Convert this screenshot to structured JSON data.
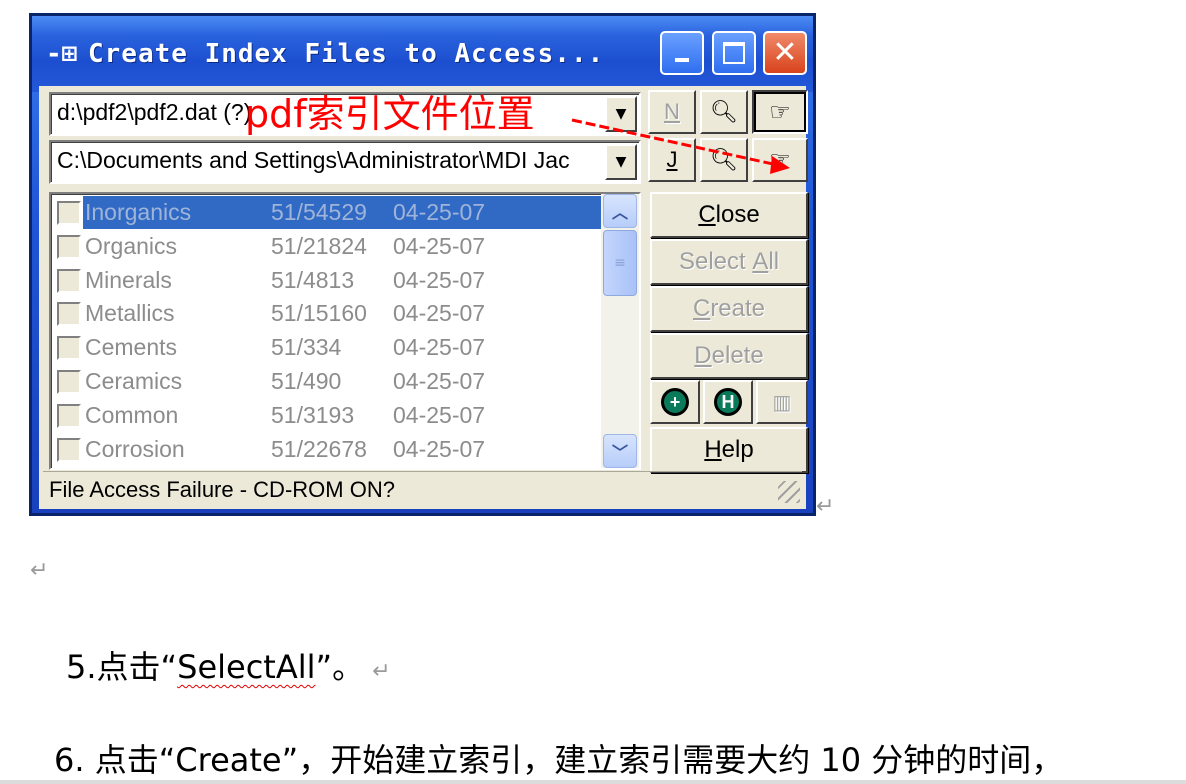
{
  "dialog": {
    "title": "Create Index Files to Access...",
    "title_icon": "pin-icon",
    "combo1_value": "d:\\pdf2\\pdf2.dat (?)",
    "combo2_value": "C:\\Documents and Settings\\Administrator\\MDI Jac",
    "btn_n_label": "N",
    "btn_j_label": "J",
    "annotation": "pdf索引文件位置",
    "list_rows": [
      {
        "name": "Inorganics",
        "count": "51/54529",
        "date": "04-25-07"
      },
      {
        "name": "Organics",
        "count": "51/21824",
        "date": "04-25-07"
      },
      {
        "name": "Minerals",
        "count": "51/4813",
        "date": "04-25-07"
      },
      {
        "name": "Metallics",
        "count": "51/15160",
        "date": "04-25-07"
      },
      {
        "name": "Cements",
        "count": "51/334",
        "date": "04-25-07"
      },
      {
        "name": "Ceramics",
        "count": "51/490",
        "date": "04-25-07"
      },
      {
        "name": "Common",
        "count": "51/3193",
        "date": "04-25-07"
      },
      {
        "name": "Corrosion",
        "count": "51/22678",
        "date": "04-25-07"
      }
    ],
    "buttons": {
      "close": {
        "first": "C",
        "rest": "lose"
      },
      "select_all": {
        "before": "Select ",
        "u": "A",
        "after": "ll"
      },
      "create": {
        "first": "C",
        "rest": "reate"
      },
      "delete": {
        "first": "D",
        "rest": "elete"
      },
      "help": {
        "first": "H",
        "rest": "elp"
      }
    },
    "status": "File Access Failure - CD-ROM ON?"
  },
  "doc": {
    "para_mark": "↵",
    "line5_prefix": "5.点击“",
    "line5_word": "SelectAll",
    "line5_suffix": "”。",
    "line6": "6.  点击“Create”，开始建立索引，建立索引需要大约 10 分钟的时间，"
  }
}
